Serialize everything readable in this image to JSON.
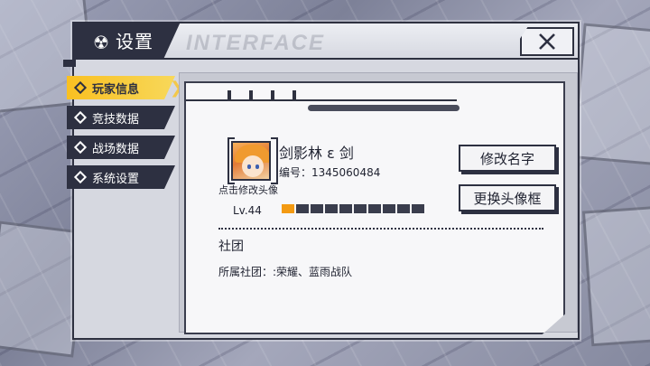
{
  "window": {
    "title": "设置",
    "title_icon": "radiation-icon",
    "watermark": "INTERFACE",
    "close_icon": "close-icon"
  },
  "sidebar": {
    "items": [
      {
        "label": "玩家信息",
        "active": true
      },
      {
        "label": "竞技数据",
        "active": false
      },
      {
        "label": "战场数据",
        "active": false
      },
      {
        "label": "系统设置",
        "active": false
      }
    ]
  },
  "player": {
    "name": "剑影林 ε 剑",
    "id_text": "编号：1345060484",
    "avatar_hint": "点击修改头像",
    "level": "Lv.44",
    "xp_segments_total": 10,
    "xp_segments_filled": 1
  },
  "buttons": {
    "rename": "修改名字",
    "change_frame": "更换头像框"
  },
  "club": {
    "title": "社团",
    "line": "所属社团：:荣耀、蓝雨战队"
  },
  "colors": {
    "accent": "#f9c021",
    "dark": "#2d3041",
    "xp_fill": "#f39a12"
  }
}
